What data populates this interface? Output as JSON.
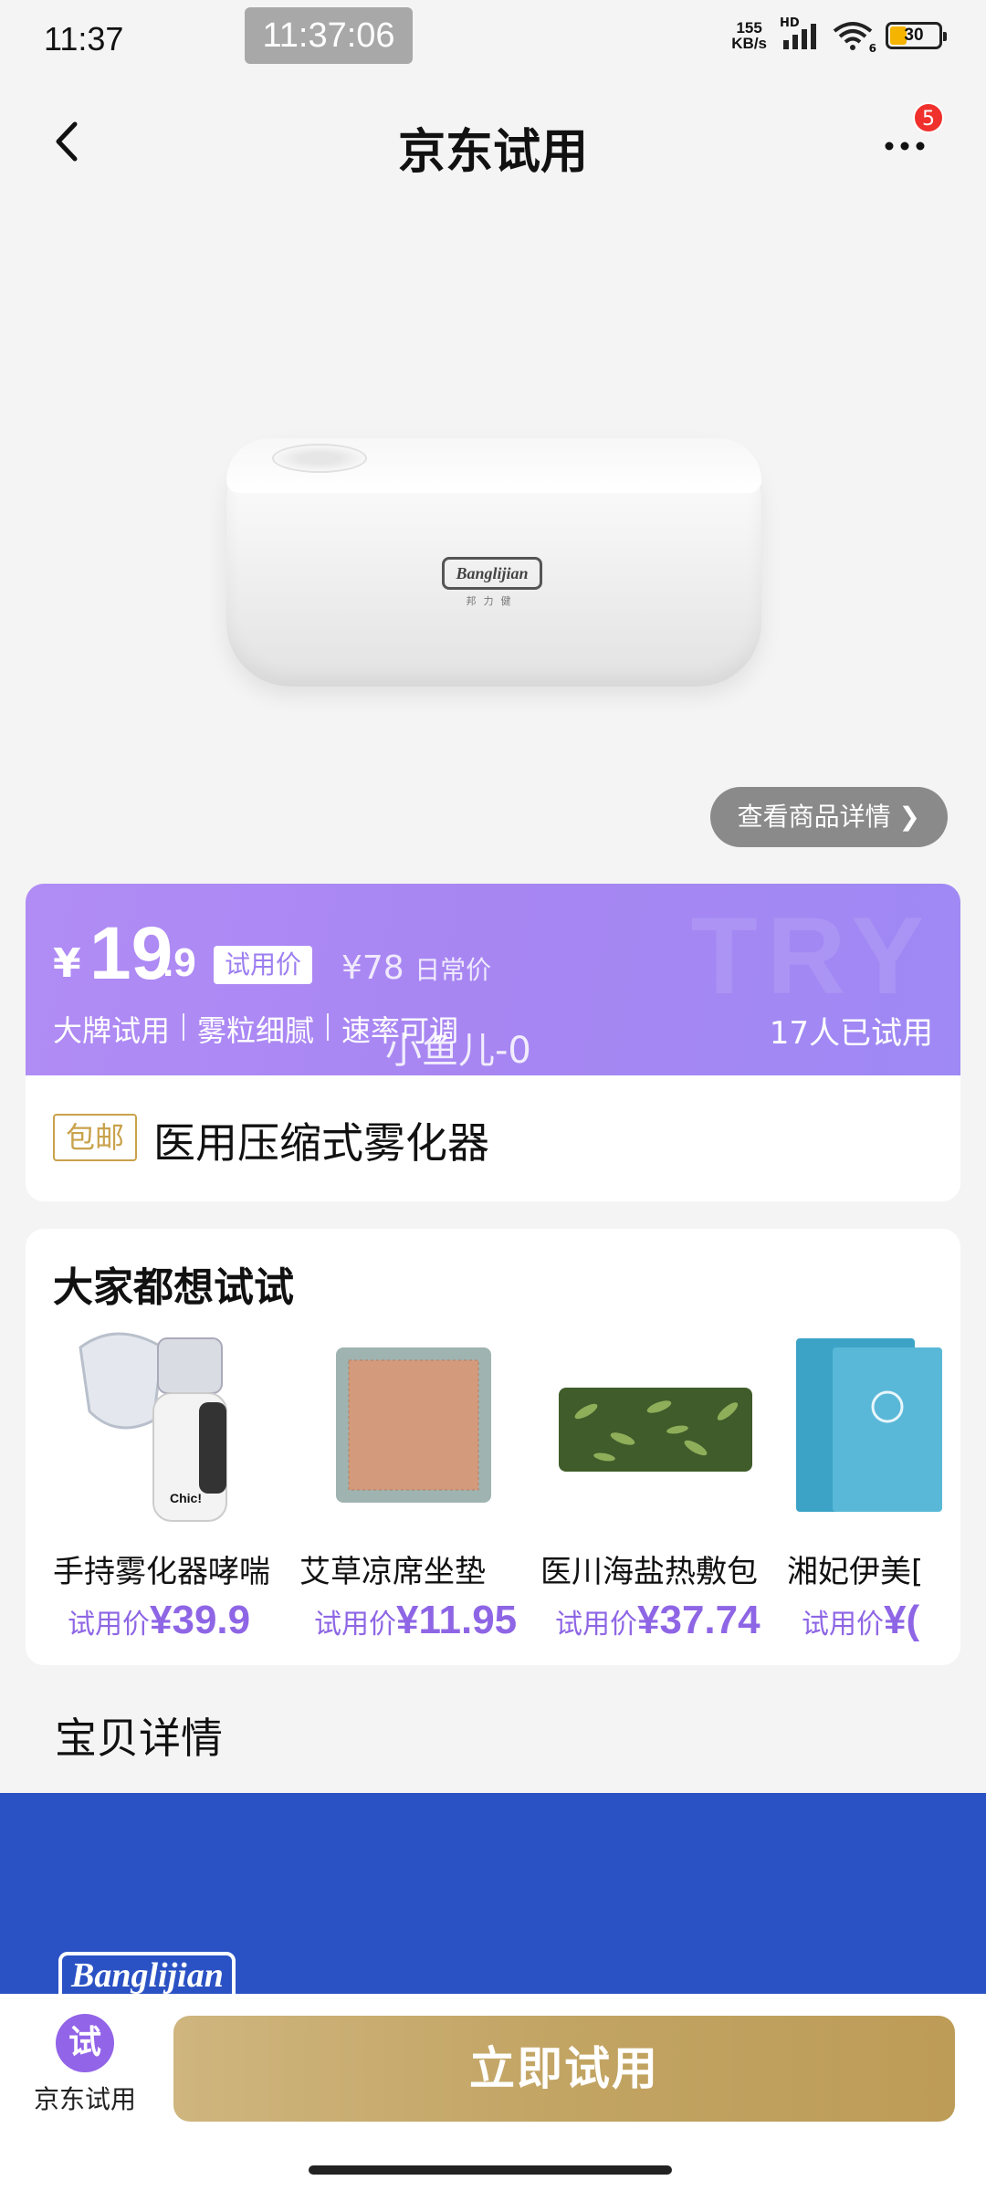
{
  "status_bar": {
    "time": "11:37",
    "clock_overlay": "11:37:06",
    "net_speed_value": "155",
    "net_speed_unit": "KB/s",
    "signal_label": "HD",
    "wifi_label": "6",
    "battery_level": "30"
  },
  "nav": {
    "title": "京东试用",
    "badge_count": "5",
    "back_icon": "chevron-left-icon",
    "more_icon": "more-dots-icon"
  },
  "hero": {
    "brand_logo": "Banglijian",
    "brand_logo_sub": "邦力健",
    "detail_button": "查看商品详情 ❯"
  },
  "price": {
    "currency": "¥",
    "integer": "19",
    "decimal": ".9",
    "tag": "试用价",
    "original_price": "¥78",
    "original_label": "日常价",
    "watermark": "TRY",
    "features": [
      "大牌试用",
      "雾粒细腻",
      "速率可调"
    ],
    "tried_count": "17人已试用",
    "overlay_text": "小鱼儿-0",
    "accent_color": "#a786f2"
  },
  "product": {
    "free_shipping": "包邮",
    "name": "医用压缩式雾化器"
  },
  "recommendations": {
    "title": "大家都想试试",
    "items": [
      {
        "name": "手持雾化器哮喘",
        "price_label": "试用价",
        "price": "¥39.9"
      },
      {
        "name": "艾草凉席坐垫",
        "price_label": "试用价",
        "price": "¥11.95"
      },
      {
        "name": "医川海盐热敷包",
        "price_label": "试用价",
        "price": "¥37.74"
      },
      {
        "name": "湘妃伊美[",
        "price_label": "试用价",
        "price": "¥("
      }
    ]
  },
  "details": {
    "heading": "宝贝详情",
    "banner_logo": "Banglijian"
  },
  "bottom": {
    "icon_char": "试",
    "icon_label": "京东试用",
    "try_button": "立即试用"
  }
}
